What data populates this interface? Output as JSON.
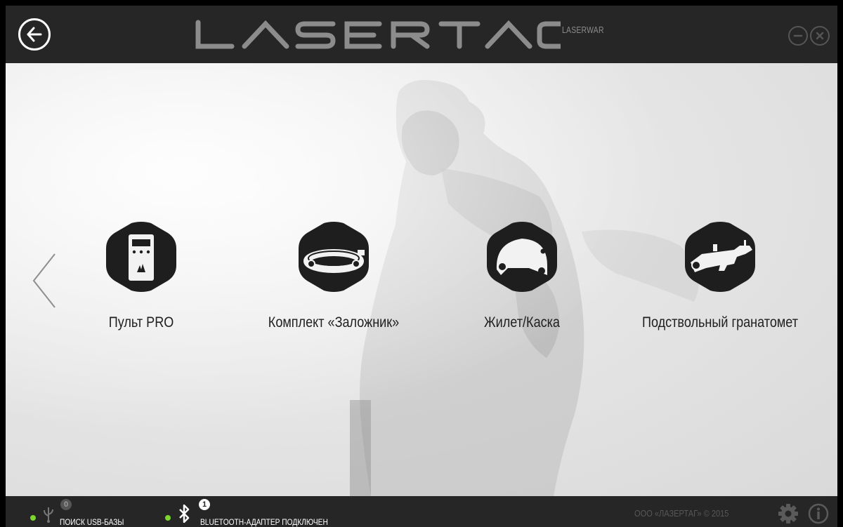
{
  "header": {
    "logo_text": "LASERTAG",
    "logo_sub": "LASERWAR",
    "icons": {
      "back": "arrow-left-icon",
      "minimize": "minimize-icon",
      "close": "close-icon"
    }
  },
  "main": {
    "nav_prev_icon": "chevron-left-icon",
    "items": [
      {
        "label": "Пульт PRO",
        "icon": "remote-control-icon"
      },
      {
        "label": "Комплект «Заложник»",
        "icon": "headband-icon"
      },
      {
        "label": "Жилет/Каска",
        "icon": "helmet-icon"
      },
      {
        "label": "Подствольный гранатомет",
        "icon": "grenade-launcher-icon"
      }
    ]
  },
  "status": {
    "usb": {
      "icon": "usb-icon",
      "count": "0",
      "text": "ПОИСК USB-БАЗЫ"
    },
    "bluetooth": {
      "icon": "bluetooth-icon",
      "count": "1",
      "text": "BLUETOOTH-АДАПТЕР ПОДКЛЮЧЕН"
    },
    "copyright": "ООО «ЛАЗЕРТАГ» © 2015",
    "settings_icon": "gear-icon",
    "info_icon": "info-icon",
    "indicator_color": "#7bd62e"
  }
}
